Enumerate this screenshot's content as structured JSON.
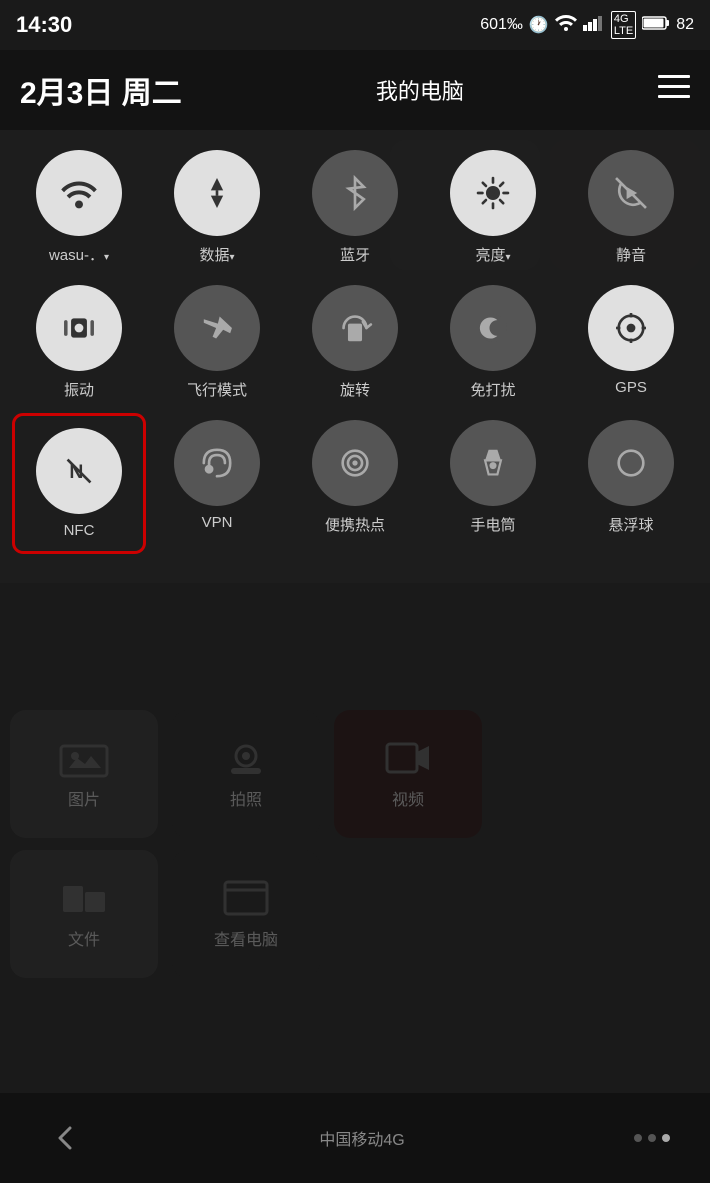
{
  "statusBar": {
    "time": "14:30",
    "signal": "601‰",
    "battery": "82"
  },
  "header": {
    "date": "2月3日 周二",
    "title": "我的电脑"
  },
  "quickSettings": {
    "row1": [
      {
        "id": "wifi",
        "label": "wasu-．▾",
        "active": true,
        "icon": "wifi"
      },
      {
        "id": "data",
        "label": "数据▾",
        "active": true,
        "icon": "data"
      },
      {
        "id": "bluetooth",
        "label": "蓝牙",
        "active": false,
        "icon": "bluetooth"
      },
      {
        "id": "brightness",
        "label": "亮度▾",
        "active": true,
        "icon": "brightness"
      },
      {
        "id": "silent",
        "label": "静音",
        "active": false,
        "icon": "silent"
      }
    ],
    "row2": [
      {
        "id": "vibrate",
        "label": "振动",
        "active": true,
        "icon": "vibrate"
      },
      {
        "id": "airplane",
        "label": "飞行模式",
        "active": false,
        "icon": "airplane"
      },
      {
        "id": "rotate",
        "label": "旋转",
        "active": false,
        "icon": "rotate"
      },
      {
        "id": "dnd",
        "label": "免打扰",
        "active": false,
        "icon": "dnd"
      },
      {
        "id": "gps",
        "label": "GPS",
        "active": true,
        "icon": "gps"
      }
    ],
    "row3": [
      {
        "id": "nfc",
        "label": "NFC",
        "active": true,
        "icon": "nfc",
        "highlighted": true
      },
      {
        "id": "vpn",
        "label": "VPN",
        "active": false,
        "icon": "vpn"
      },
      {
        "id": "hotspot",
        "label": "便携热点",
        "active": false,
        "icon": "hotspot"
      },
      {
        "id": "flashlight",
        "label": "手电筒",
        "active": false,
        "icon": "flashlight"
      },
      {
        "id": "float",
        "label": "悬浮球",
        "active": false,
        "icon": "float"
      }
    ]
  },
  "bgApps": {
    "row1": [
      {
        "label": "图片",
        "bg": "dark"
      },
      {
        "label": "拍照",
        "bg": "dark"
      },
      {
        "label": "视频",
        "bg": "darkred"
      }
    ],
    "row2": [
      {
        "label": "文件",
        "bg": "dark"
      },
      {
        "label": "查看电脑",
        "bg": "dark"
      }
    ]
  },
  "navBar": {
    "carrier": "中国移动4G",
    "backIcon": "◁"
  }
}
